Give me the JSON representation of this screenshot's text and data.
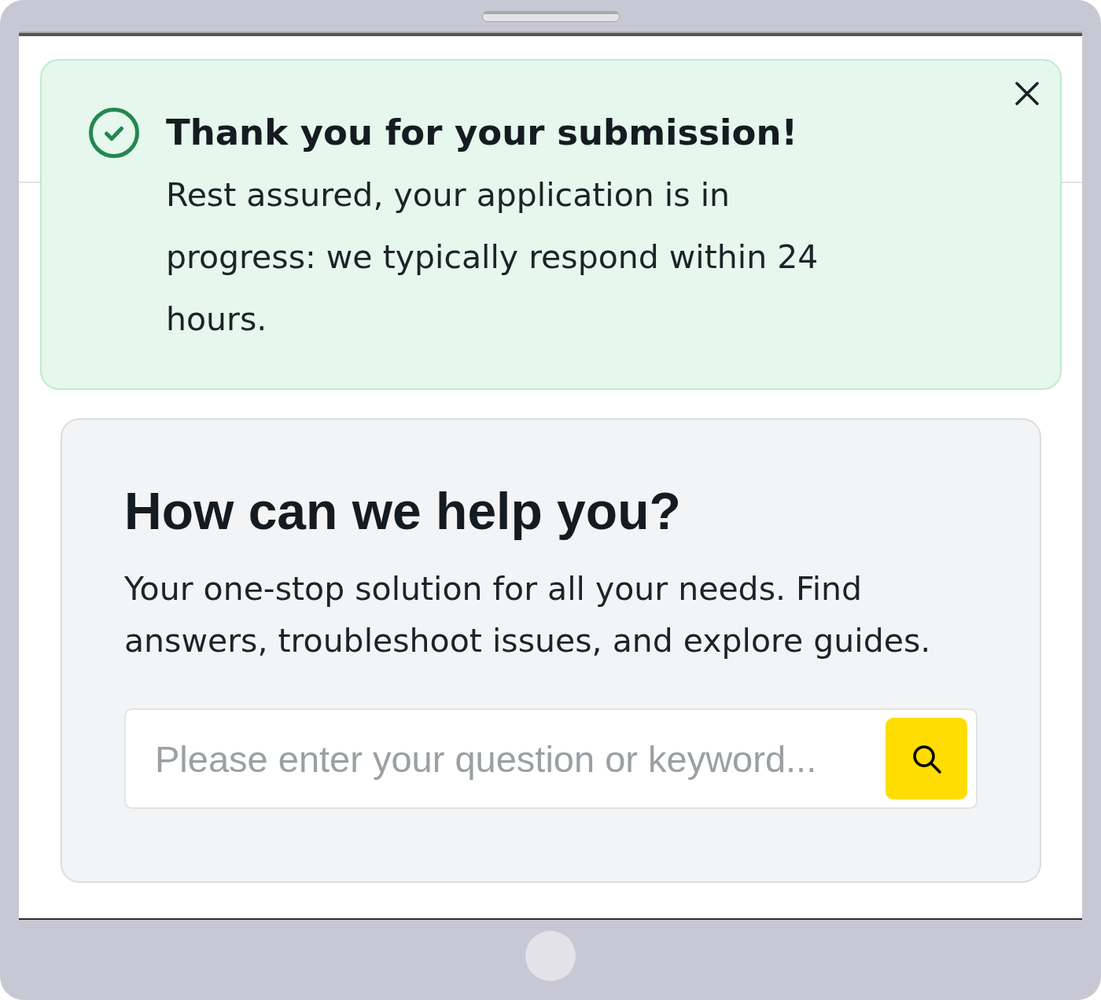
{
  "banner": {
    "title": "Thank you for your submission!",
    "message": "Rest assured, your application is in progress: we typically respond within 24 hours."
  },
  "help": {
    "heading": "How can we help you?",
    "description": "Your one-stop solution for all your needs. Find answers, troubleshoot issues, and explore guides.",
    "search": {
      "placeholder": "Please enter your question or keyword..."
    }
  }
}
